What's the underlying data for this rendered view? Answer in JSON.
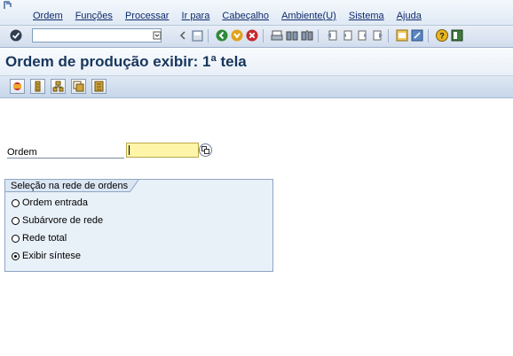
{
  "menubar": {
    "items": [
      "Ordem",
      "Funções",
      "Processar",
      "Ir para",
      "Cabeçalho",
      "Ambiente(U)",
      "Sistema",
      "Ajuda"
    ]
  },
  "toolbar": {
    "command_field": ""
  },
  "page": {
    "title": "Ordem de produção exibir: 1ª tela"
  },
  "form": {
    "ordem_label": "Ordem",
    "ordem_value": ""
  },
  "selection": {
    "title": "Seleção na rede de ordens",
    "options": [
      "Ordem entrada",
      "Subárvore de rede",
      "Rede total",
      "Exibir síntese"
    ],
    "selected_index": 3
  },
  "colors": {
    "input_bg": "#fff5a8",
    "group_bg": "#e8f0f8",
    "title_color": "#17365d"
  }
}
